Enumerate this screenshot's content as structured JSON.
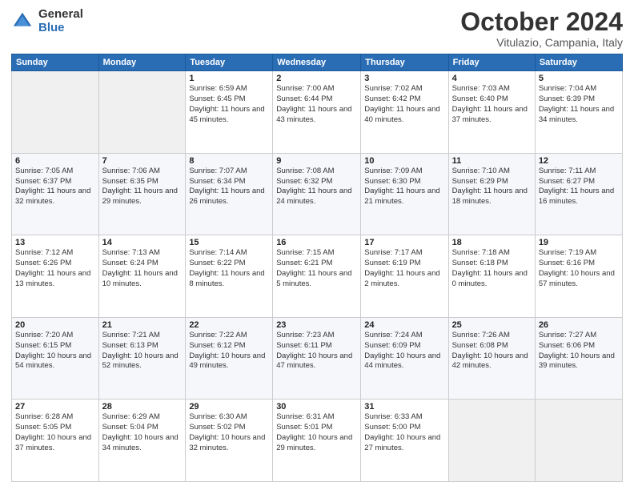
{
  "logo": {
    "general": "General",
    "blue": "Blue"
  },
  "header": {
    "month": "October 2024",
    "location": "Vitulazio, Campania, Italy"
  },
  "weekdays": [
    "Sunday",
    "Monday",
    "Tuesday",
    "Wednesday",
    "Thursday",
    "Friday",
    "Saturday"
  ],
  "weeks": [
    [
      {
        "day": "",
        "info": ""
      },
      {
        "day": "",
        "info": ""
      },
      {
        "day": "1",
        "info": "Sunrise: 6:59 AM\nSunset: 6:45 PM\nDaylight: 11 hours and 45 minutes."
      },
      {
        "day": "2",
        "info": "Sunrise: 7:00 AM\nSunset: 6:44 PM\nDaylight: 11 hours and 43 minutes."
      },
      {
        "day": "3",
        "info": "Sunrise: 7:02 AM\nSunset: 6:42 PM\nDaylight: 11 hours and 40 minutes."
      },
      {
        "day": "4",
        "info": "Sunrise: 7:03 AM\nSunset: 6:40 PM\nDaylight: 11 hours and 37 minutes."
      },
      {
        "day": "5",
        "info": "Sunrise: 7:04 AM\nSunset: 6:39 PM\nDaylight: 11 hours and 34 minutes."
      }
    ],
    [
      {
        "day": "6",
        "info": "Sunrise: 7:05 AM\nSunset: 6:37 PM\nDaylight: 11 hours and 32 minutes."
      },
      {
        "day": "7",
        "info": "Sunrise: 7:06 AM\nSunset: 6:35 PM\nDaylight: 11 hours and 29 minutes."
      },
      {
        "day": "8",
        "info": "Sunrise: 7:07 AM\nSunset: 6:34 PM\nDaylight: 11 hours and 26 minutes."
      },
      {
        "day": "9",
        "info": "Sunrise: 7:08 AM\nSunset: 6:32 PM\nDaylight: 11 hours and 24 minutes."
      },
      {
        "day": "10",
        "info": "Sunrise: 7:09 AM\nSunset: 6:30 PM\nDaylight: 11 hours and 21 minutes."
      },
      {
        "day": "11",
        "info": "Sunrise: 7:10 AM\nSunset: 6:29 PM\nDaylight: 11 hours and 18 minutes."
      },
      {
        "day": "12",
        "info": "Sunrise: 7:11 AM\nSunset: 6:27 PM\nDaylight: 11 hours and 16 minutes."
      }
    ],
    [
      {
        "day": "13",
        "info": "Sunrise: 7:12 AM\nSunset: 6:26 PM\nDaylight: 11 hours and 13 minutes."
      },
      {
        "day": "14",
        "info": "Sunrise: 7:13 AM\nSunset: 6:24 PM\nDaylight: 11 hours and 10 minutes."
      },
      {
        "day": "15",
        "info": "Sunrise: 7:14 AM\nSunset: 6:22 PM\nDaylight: 11 hours and 8 minutes."
      },
      {
        "day": "16",
        "info": "Sunrise: 7:15 AM\nSunset: 6:21 PM\nDaylight: 11 hours and 5 minutes."
      },
      {
        "day": "17",
        "info": "Sunrise: 7:17 AM\nSunset: 6:19 PM\nDaylight: 11 hours and 2 minutes."
      },
      {
        "day": "18",
        "info": "Sunrise: 7:18 AM\nSunset: 6:18 PM\nDaylight: 11 hours and 0 minutes."
      },
      {
        "day": "19",
        "info": "Sunrise: 7:19 AM\nSunset: 6:16 PM\nDaylight: 10 hours and 57 minutes."
      }
    ],
    [
      {
        "day": "20",
        "info": "Sunrise: 7:20 AM\nSunset: 6:15 PM\nDaylight: 10 hours and 54 minutes."
      },
      {
        "day": "21",
        "info": "Sunrise: 7:21 AM\nSunset: 6:13 PM\nDaylight: 10 hours and 52 minutes."
      },
      {
        "day": "22",
        "info": "Sunrise: 7:22 AM\nSunset: 6:12 PM\nDaylight: 10 hours and 49 minutes."
      },
      {
        "day": "23",
        "info": "Sunrise: 7:23 AM\nSunset: 6:11 PM\nDaylight: 10 hours and 47 minutes."
      },
      {
        "day": "24",
        "info": "Sunrise: 7:24 AM\nSunset: 6:09 PM\nDaylight: 10 hours and 44 minutes."
      },
      {
        "day": "25",
        "info": "Sunrise: 7:26 AM\nSunset: 6:08 PM\nDaylight: 10 hours and 42 minutes."
      },
      {
        "day": "26",
        "info": "Sunrise: 7:27 AM\nSunset: 6:06 PM\nDaylight: 10 hours and 39 minutes."
      }
    ],
    [
      {
        "day": "27",
        "info": "Sunrise: 6:28 AM\nSunset: 5:05 PM\nDaylight: 10 hours and 37 minutes."
      },
      {
        "day": "28",
        "info": "Sunrise: 6:29 AM\nSunset: 5:04 PM\nDaylight: 10 hours and 34 minutes."
      },
      {
        "day": "29",
        "info": "Sunrise: 6:30 AM\nSunset: 5:02 PM\nDaylight: 10 hours and 32 minutes."
      },
      {
        "day": "30",
        "info": "Sunrise: 6:31 AM\nSunset: 5:01 PM\nDaylight: 10 hours and 29 minutes."
      },
      {
        "day": "31",
        "info": "Sunrise: 6:33 AM\nSunset: 5:00 PM\nDaylight: 10 hours and 27 minutes."
      },
      {
        "day": "",
        "info": ""
      },
      {
        "day": "",
        "info": ""
      }
    ]
  ]
}
